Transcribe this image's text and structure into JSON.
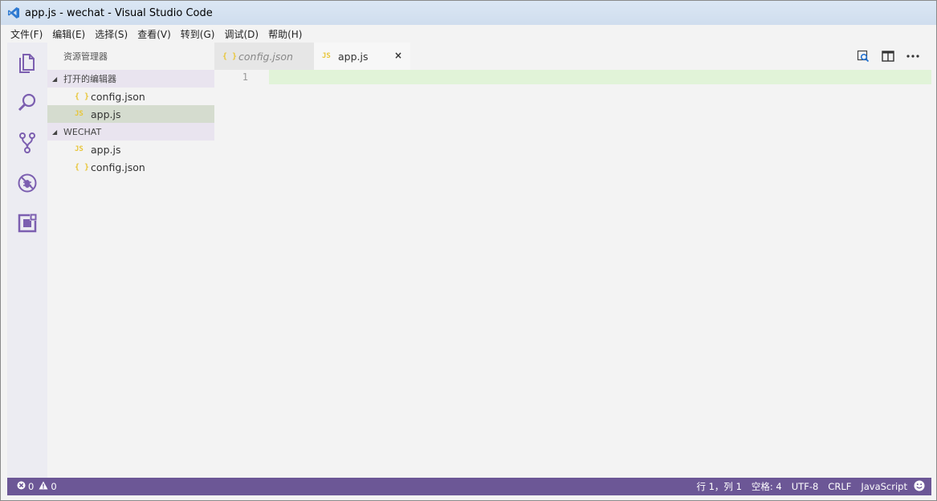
{
  "window": {
    "title": "app.js - wechat - Visual Studio Code"
  },
  "menu": [
    "文件(F)",
    "编辑(E)",
    "选择(S)",
    "查看(V)",
    "转到(G)",
    "调试(D)",
    "帮助(H)"
  ],
  "sidebar": {
    "header": "资源管理器",
    "open_editors": {
      "label": "打开的编辑器",
      "files": [
        {
          "name": "config.json",
          "icon": "{ }",
          "type": "json"
        },
        {
          "name": "app.js",
          "icon": "JS",
          "type": "js"
        }
      ]
    },
    "folder": {
      "label": "WECHAT",
      "files": [
        {
          "name": "app.js",
          "icon": "JS",
          "type": "js"
        },
        {
          "name": "config.json",
          "icon": "{ }",
          "type": "json"
        }
      ]
    }
  },
  "editor": {
    "tabs": [
      {
        "name": "config.json",
        "icon": "{ }"
      },
      {
        "name": "app.js",
        "icon": "JS",
        "close": "×"
      }
    ],
    "line_number": "1"
  },
  "status": {
    "errors": "0",
    "warnings": "0",
    "position": "行 1，列 1",
    "indent": "空格: 4",
    "encoding": "UTF-8",
    "eol": "CRLF",
    "language": "JavaScript"
  },
  "colors": {
    "statusbar": "#6c5796",
    "activitybar_icons": "#7c5fb0",
    "line_highlight": "#e1f3d8"
  }
}
